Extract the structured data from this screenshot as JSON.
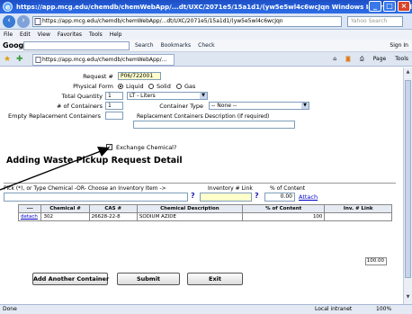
{
  "window": {
    "title": "https://app.mcg.edu/chemdb/chemWebApp/...dt/UXC/2071e5/15a1d1/(yw5e5wl4c6wcJqn   Windows Internet Explorer"
  },
  "address": {
    "url": "https://app.mcg.edu/chemdb/chemWebApp/...dt/UXC/2071e5/15a1d1/(yw5e5wl4c6wcJqn",
    "search_placeholder": "Yahoo Search"
  },
  "menu": [
    "File",
    "Edit",
    "View",
    "Favorites",
    "Tools",
    "Help"
  ],
  "googlebar": {
    "logo": "Google",
    "tools": [
      "Search",
      "Bookmarks",
      "Check"
    ],
    "signin": "Sign In"
  },
  "tab": {
    "title": "https://app.mcg.edu/chemdb/chemWebApp/..."
  },
  "command_bar": [
    "Page",
    "Tools"
  ],
  "form": {
    "request_label": "Request #",
    "request_value": "P06/722001",
    "physical_label": "Physical Form",
    "physical_options": [
      "Liquid",
      "Solid",
      "Gas"
    ],
    "physical_selected": "Liquid",
    "qty_label": "Total Quantity",
    "qty_value": "1",
    "unit_value": "LT - Liters",
    "containers_label": "# of Containers",
    "containers_value": "1",
    "container_type_label": "Container Type",
    "container_type_value": "-- None --",
    "empty_label": "Empty Replacement Containers",
    "replacement_desc_label": "Replacement Containers Description (If required)",
    "exchange_label": "Exchange Chemical?"
  },
  "section": {
    "heading": "Adding Waste Pickup Request Detail"
  },
  "pick": {
    "instruction": "Pick (*), or Type Chemical -OR- Choose an Inventory Item ->",
    "inventory_label": "Inventory # Link",
    "percent_label": "% of Content",
    "percent_value": "0.00",
    "attach_label": "Attach"
  },
  "table": {
    "columns": [
      "---",
      "Chemical #",
      "CAS #",
      "Chemical Description",
      "% of Content",
      "Inv. # Link"
    ],
    "rows": [
      [
        "detach",
        "302",
        "26628-22-8",
        "SODIUM AZIDE",
        "100",
        ""
      ]
    ],
    "total": "100.00"
  },
  "buttons": {
    "add_container": "Add Another Container",
    "submit": "Submit",
    "exit": "Exit"
  },
  "status": {
    "done": "Done",
    "zone": "Local intranet",
    "zoom": "100%"
  },
  "colors": {
    "titlebar": "#2e6ee8",
    "highlight_field": "#ffffcc",
    "link": "#0000cc"
  }
}
